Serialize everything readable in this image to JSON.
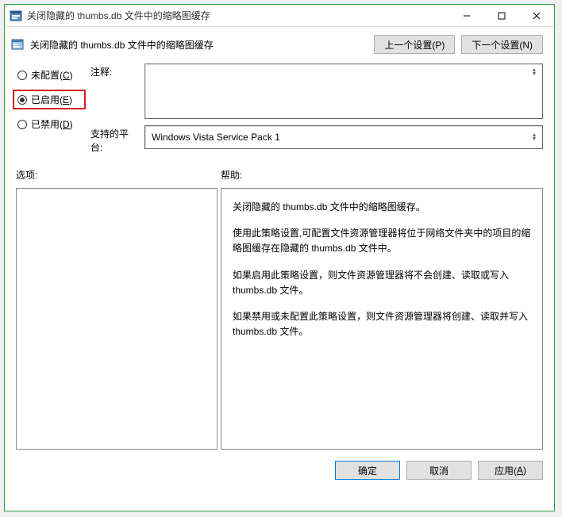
{
  "window": {
    "title": "关闭隐藏的 thumbs.db 文件中的缩略图缓存"
  },
  "header": {
    "title": "关闭隐藏的 thumbs.db 文件中的缩略图缓存",
    "prev_button": "上一个设置(P)",
    "next_button": "下一个设置(N)"
  },
  "radios": {
    "not_configured": {
      "label": "未配置(",
      "key": "C",
      "suffix": ")"
    },
    "enabled": {
      "label": "已启用(",
      "key": "E",
      "suffix": ")"
    },
    "disabled": {
      "label": "已禁用(",
      "key": "D",
      "suffix": ")"
    }
  },
  "fields": {
    "comment_label": "注释:",
    "comment_value": "",
    "platform_label": "支持的平台:",
    "platform_value": "Windows Vista Service Pack 1"
  },
  "sections": {
    "options_label": "选项:",
    "help_label": "帮助:"
  },
  "help": {
    "p1": "关闭隐藏的 thumbs.db 文件中的缩略图缓存。",
    "p2": "使用此策略设置,可配置文件资源管理器将位于网络文件夹中的项目的缩略图缓存在隐藏的 thumbs.db 文件中。",
    "p3": "如果启用此策略设置，则文件资源管理器将不会创建、读取或写入 thumbs.db 文件。",
    "p4": "如果禁用或未配置此策略设置，则文件资源管理器将创建、读取并写入 thumbs.db 文件。"
  },
  "footer": {
    "ok": "确定",
    "cancel": "取消",
    "apply": "应用(",
    "apply_key": "A",
    "apply_suffix": ")"
  }
}
